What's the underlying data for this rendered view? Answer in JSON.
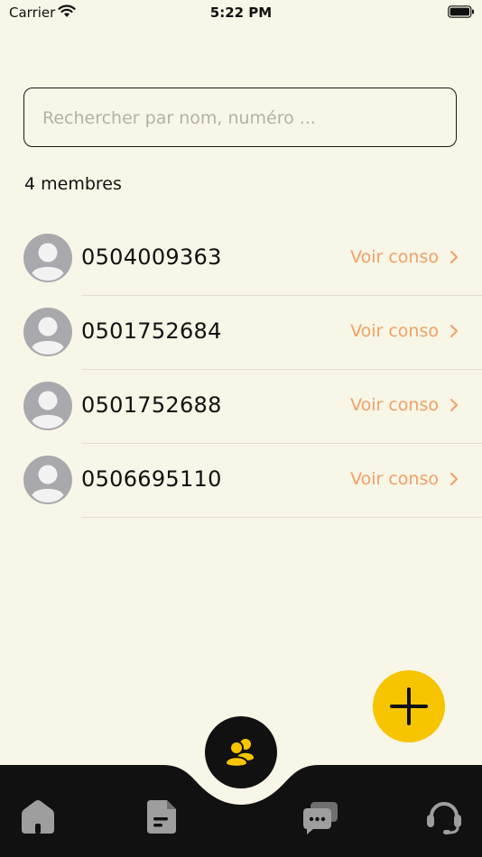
{
  "status_bar": {
    "carrier": "Carrier",
    "time": "5:22 PM"
  },
  "search": {
    "placeholder": "Rechercher par nom, numéro ..."
  },
  "members": {
    "count_label": "4 membres",
    "action_label": "Voir conso",
    "items": [
      {
        "phone": "0504009363"
      },
      {
        "phone": "0501752684"
      },
      {
        "phone": "0501752688"
      },
      {
        "phone": "0506695110"
      }
    ]
  },
  "colors": {
    "background": "#f8f6e6",
    "accent": "#f6c500",
    "link": "#f0a068",
    "nav": "#111111"
  },
  "icons": {
    "fab": "plus-icon",
    "center": "group-icon",
    "nav": [
      "home-icon",
      "document-icon",
      "chat-icon",
      "support-headset-icon"
    ]
  }
}
